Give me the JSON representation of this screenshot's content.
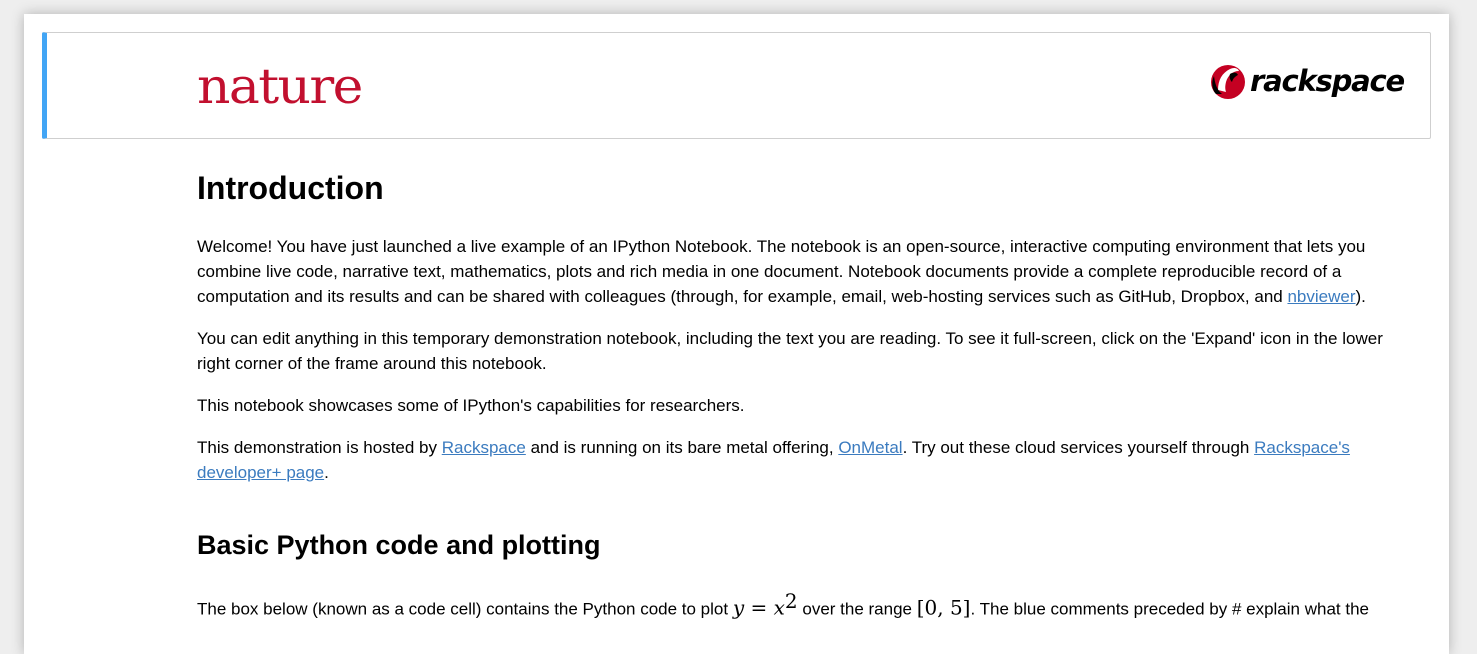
{
  "header": {
    "nature_logo": "nature",
    "rackspace_logo": "rackspace",
    "accent_color": "#42a5f5",
    "nature_color": "#c2102f",
    "rackspace_color": "#c40022"
  },
  "intro": {
    "heading": "Introduction",
    "p1": "Welcome! You have just launched a live example of an IPython Notebook. The notebook is an open-source, interactive computing environment that lets you combine live code, narrative text, mathematics, plots and rich media in one document. Notebook documents provide a complete reproducible record of a computation and its results and can be shared with colleagues (through, for example, email, web-hosting services such as GitHub, Dropbox, and ",
    "p1_link": "nbviewer",
    "p1_end": ").",
    "p2": "You can edit anything in this temporary demonstration notebook, including the text you are reading. To see it full-screen, click on the 'Expand' icon in the lower right corner of the frame around this notebook.",
    "p3": "This notebook showcases some of IPython's capabilities for researchers.",
    "p4_a": "This demonstration is hosted by ",
    "p4_link1": "Rackspace",
    "p4_b": " and is running on its bare metal offering, ",
    "p4_link2": "OnMetal",
    "p4_c": ". Try out these cloud services yourself through ",
    "p4_link3": "Rackspace's developer+ page",
    "p4_d": "."
  },
  "basic": {
    "heading": "Basic Python code and plotting",
    "p1_a": "The box below (known as a code cell) contains the Python code to plot ",
    "math_y": "y",
    "math_eq": " = ",
    "math_x": "x",
    "math_exp": "2",
    "p1_b": " over the range ",
    "math_range": "[0, 5]",
    "p1_c": ". The blue comments preceded by # explain what the"
  },
  "link_color": "#3b7bbf"
}
